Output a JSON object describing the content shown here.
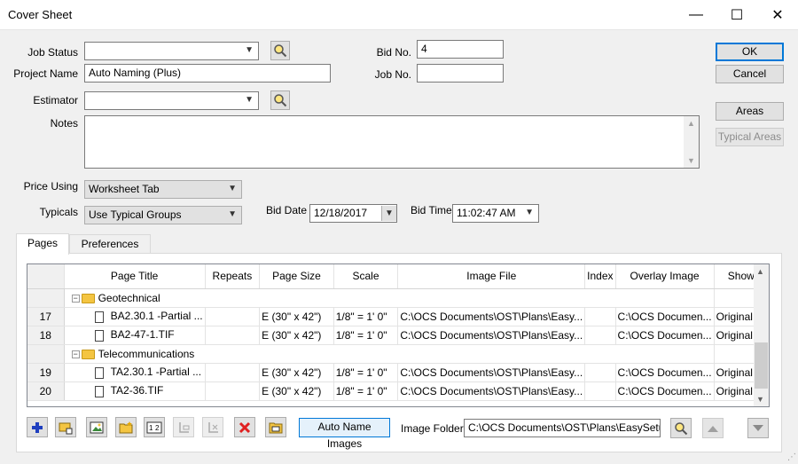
{
  "window": {
    "title": "Cover Sheet",
    "minimize": "—",
    "maximize": "☐",
    "close": "✕"
  },
  "form": {
    "job_status_label": "Job Status",
    "job_status_value": "",
    "project_name_label": "Project Name",
    "project_name_value": "Auto Naming (Plus)",
    "estimator_label": "Estimator",
    "estimator_value": "",
    "notes_label": "Notes",
    "notes_value": "",
    "bid_no_label": "Bid No.",
    "bid_no_value": "4",
    "job_no_label": "Job No.",
    "job_no_value": "",
    "price_using_label": "Price Using",
    "price_using_value": "Worksheet Tab",
    "typicals_label": "Typicals",
    "typicals_value": "Use Typical Groups",
    "bid_date_label": "Bid Date",
    "bid_date_value": "12/18/2017",
    "bid_time_label": "Bid Time",
    "bid_time_value": "11:02:47 AM"
  },
  "buttons": {
    "ok": "OK",
    "cancel": "Cancel",
    "areas": "Areas",
    "typical_areas": "Typical Areas",
    "auto_name_images": "Auto Name Images"
  },
  "tabs": [
    {
      "label": "Pages",
      "active": true
    },
    {
      "label": "Preferences",
      "active": false
    }
  ],
  "grid": {
    "columns": [
      "",
      "Page Title",
      "Repeats",
      "Page Size",
      "Scale",
      "Image File",
      "Index",
      "Overlay Image",
      "Show"
    ],
    "rows": [
      {
        "type": "group",
        "num": "",
        "title": "Geotechnical"
      },
      {
        "type": "page",
        "num": "17",
        "title": "BA2.30.1 -Partial ...",
        "repeats": "",
        "size": "E (30\" x 42\")",
        "scale": "1/8\" = 1' 0\"",
        "image": "C:\\OCS Documents\\OST\\Plans\\Easy...",
        "index": "",
        "overlay": "C:\\OCS Documen...",
        "show": "Original"
      },
      {
        "type": "page",
        "num": "18",
        "title": "BA2-47-1.TIF",
        "repeats": "",
        "size": "E (30\" x 42\")",
        "scale": "1/8\" = 1' 0\"",
        "image": "C:\\OCS Documents\\OST\\Plans\\Easy...",
        "index": "",
        "overlay": "C:\\OCS Documen...",
        "show": "Original"
      },
      {
        "type": "group",
        "num": "",
        "title": "Telecommunications"
      },
      {
        "type": "page",
        "num": "19",
        "title": "TA2.30.1 -Partial ...",
        "repeats": "",
        "size": "E (30\" x 42\")",
        "scale": "1/8\" = 1' 0\"",
        "image": "C:\\OCS Documents\\OST\\Plans\\Easy...",
        "index": "",
        "overlay": "C:\\OCS Documen...",
        "show": "Original"
      },
      {
        "type": "page",
        "num": "20",
        "title": "TA2-36.TIF",
        "repeats": "",
        "size": "E (30\" x 42\")",
        "scale": "1/8\" = 1' 0\"",
        "image": "C:\\OCS Documents\\OST\\Plans\\Easy...",
        "index": "",
        "overlay": "C:\\OCS Documen...",
        "show": "Original"
      }
    ]
  },
  "footer": {
    "image_folder_label": "Image Folder",
    "image_folder_value": "C:\\OCS Documents\\OST\\Plans\\EasySetup"
  },
  "toolbar_icons": [
    "add-icon",
    "insert-page-icon",
    "image-icon",
    "new-folder-icon",
    "renumber-icon",
    "indent-icon",
    "unindent-icon",
    "delete-icon",
    "folder-icon"
  ],
  "colors": {
    "accent": "#0078d7",
    "add": "#1f3fbf",
    "delete": "#e02020",
    "folder": "#f4c542"
  }
}
